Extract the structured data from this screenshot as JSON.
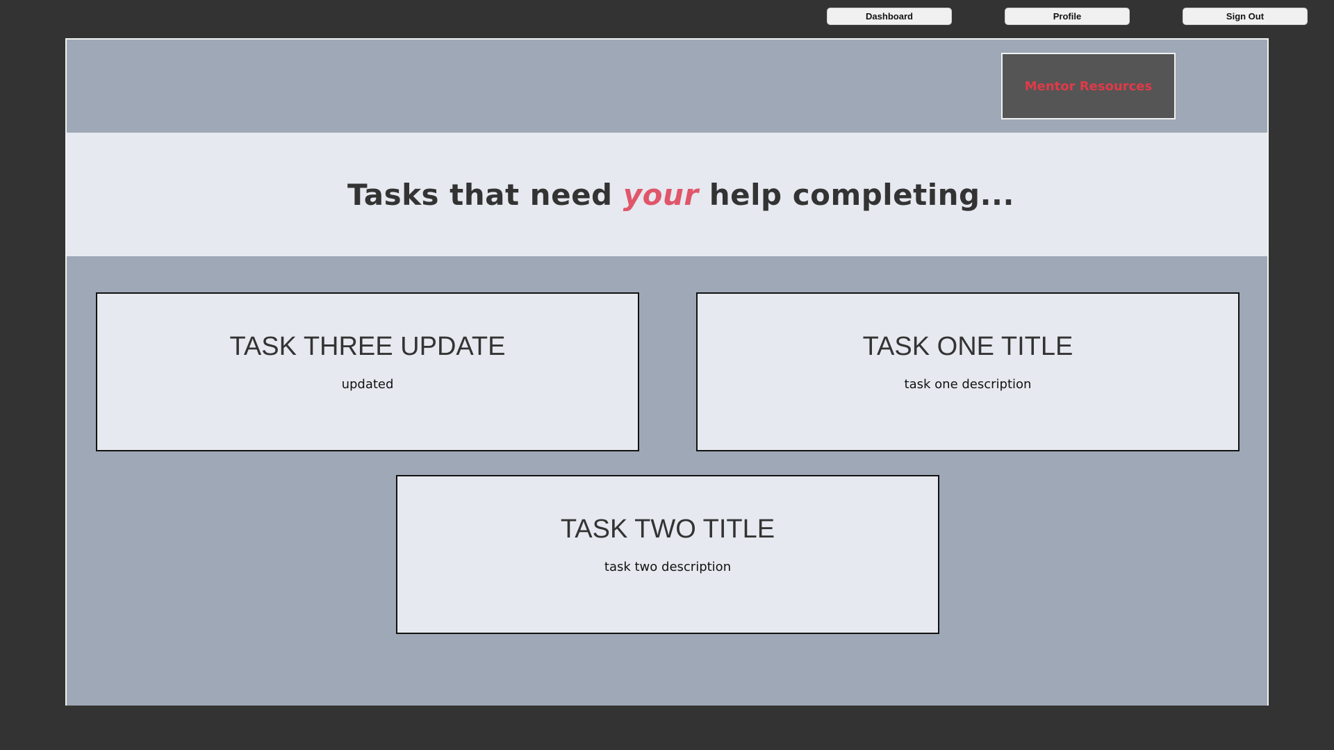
{
  "topnav": {
    "dashboard_label": "Dashboard",
    "profile_label": "Profile",
    "signout_label": "Sign Out"
  },
  "header": {
    "mentor_resources_label": "Mentor Resources"
  },
  "title": {
    "prefix": "Tasks that need ",
    "accent": "your",
    "suffix": " help completing..."
  },
  "tasks": [
    {
      "title": "TASK THREE UPDATE",
      "description": "updated"
    },
    {
      "title": "TASK ONE TITLE",
      "description": "task one description"
    },
    {
      "title": "TASK TWO TITLE",
      "description": "task two description"
    }
  ],
  "colors": {
    "background": "#333333",
    "panel": "#9ea8b6",
    "light_band": "#e6e9ef",
    "accent": "#e0566a",
    "mentor_text": "#e03a48"
  }
}
